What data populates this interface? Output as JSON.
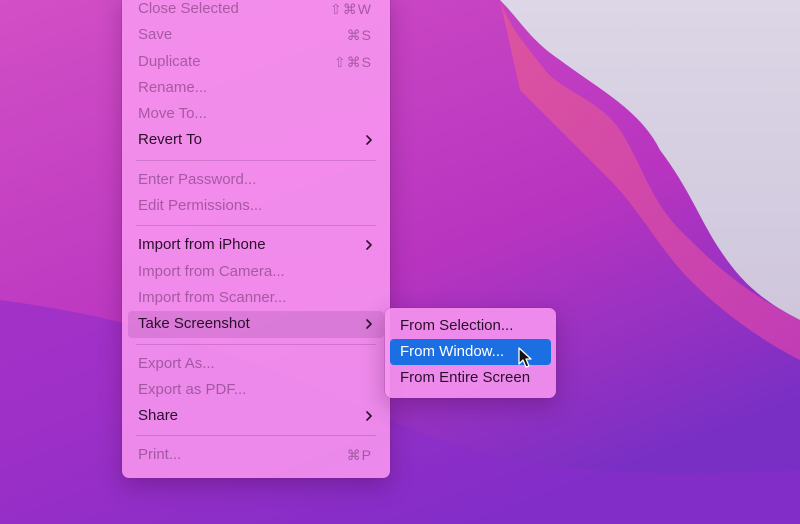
{
  "colors": {
    "menu_background": "#f896f0",
    "highlight": "#1c6fe3",
    "wallpaper_main": "#c23cbf",
    "wallpaper_light": "#d8d2e4"
  },
  "file_menu": {
    "items": [
      {
        "label": "Close Selected",
        "shortcut": "⇧⌘W",
        "enabled": false
      },
      {
        "label": "Save",
        "shortcut": "⌘S",
        "enabled": false
      },
      {
        "label": "Duplicate",
        "shortcut": "⇧⌘S",
        "enabled": false
      },
      {
        "label": "Rename...",
        "enabled": false
      },
      {
        "label": "Move To...",
        "enabled": false
      },
      {
        "label": "Revert To",
        "enabled": true,
        "submenu": true
      },
      {
        "label": "Enter Password...",
        "enabled": false
      },
      {
        "label": "Edit Permissions...",
        "enabled": false
      },
      {
        "label": "Import from iPhone",
        "enabled": true,
        "submenu": true
      },
      {
        "label": "Import from Camera...",
        "enabled": false
      },
      {
        "label": "Import from Scanner...",
        "enabled": false
      },
      {
        "label": "Take Screenshot",
        "enabled": true,
        "submenu": true,
        "hovered": true
      },
      {
        "label": "Export As...",
        "enabled": false
      },
      {
        "label": "Export as PDF...",
        "enabled": false
      },
      {
        "label": "Share",
        "enabled": true,
        "submenu": true
      },
      {
        "label": "Print...",
        "shortcut": "⌘P",
        "enabled": false
      }
    ]
  },
  "screenshot_submenu": {
    "items": [
      {
        "label": "From Selection...",
        "enabled": true
      },
      {
        "label": "From Window...",
        "enabled": true,
        "highlighted": true
      },
      {
        "label": "From Entire Screen",
        "enabled": true
      }
    ]
  },
  "icons": {
    "chevron": "chevron-right-icon",
    "cursor": "arrow-cursor-icon"
  }
}
